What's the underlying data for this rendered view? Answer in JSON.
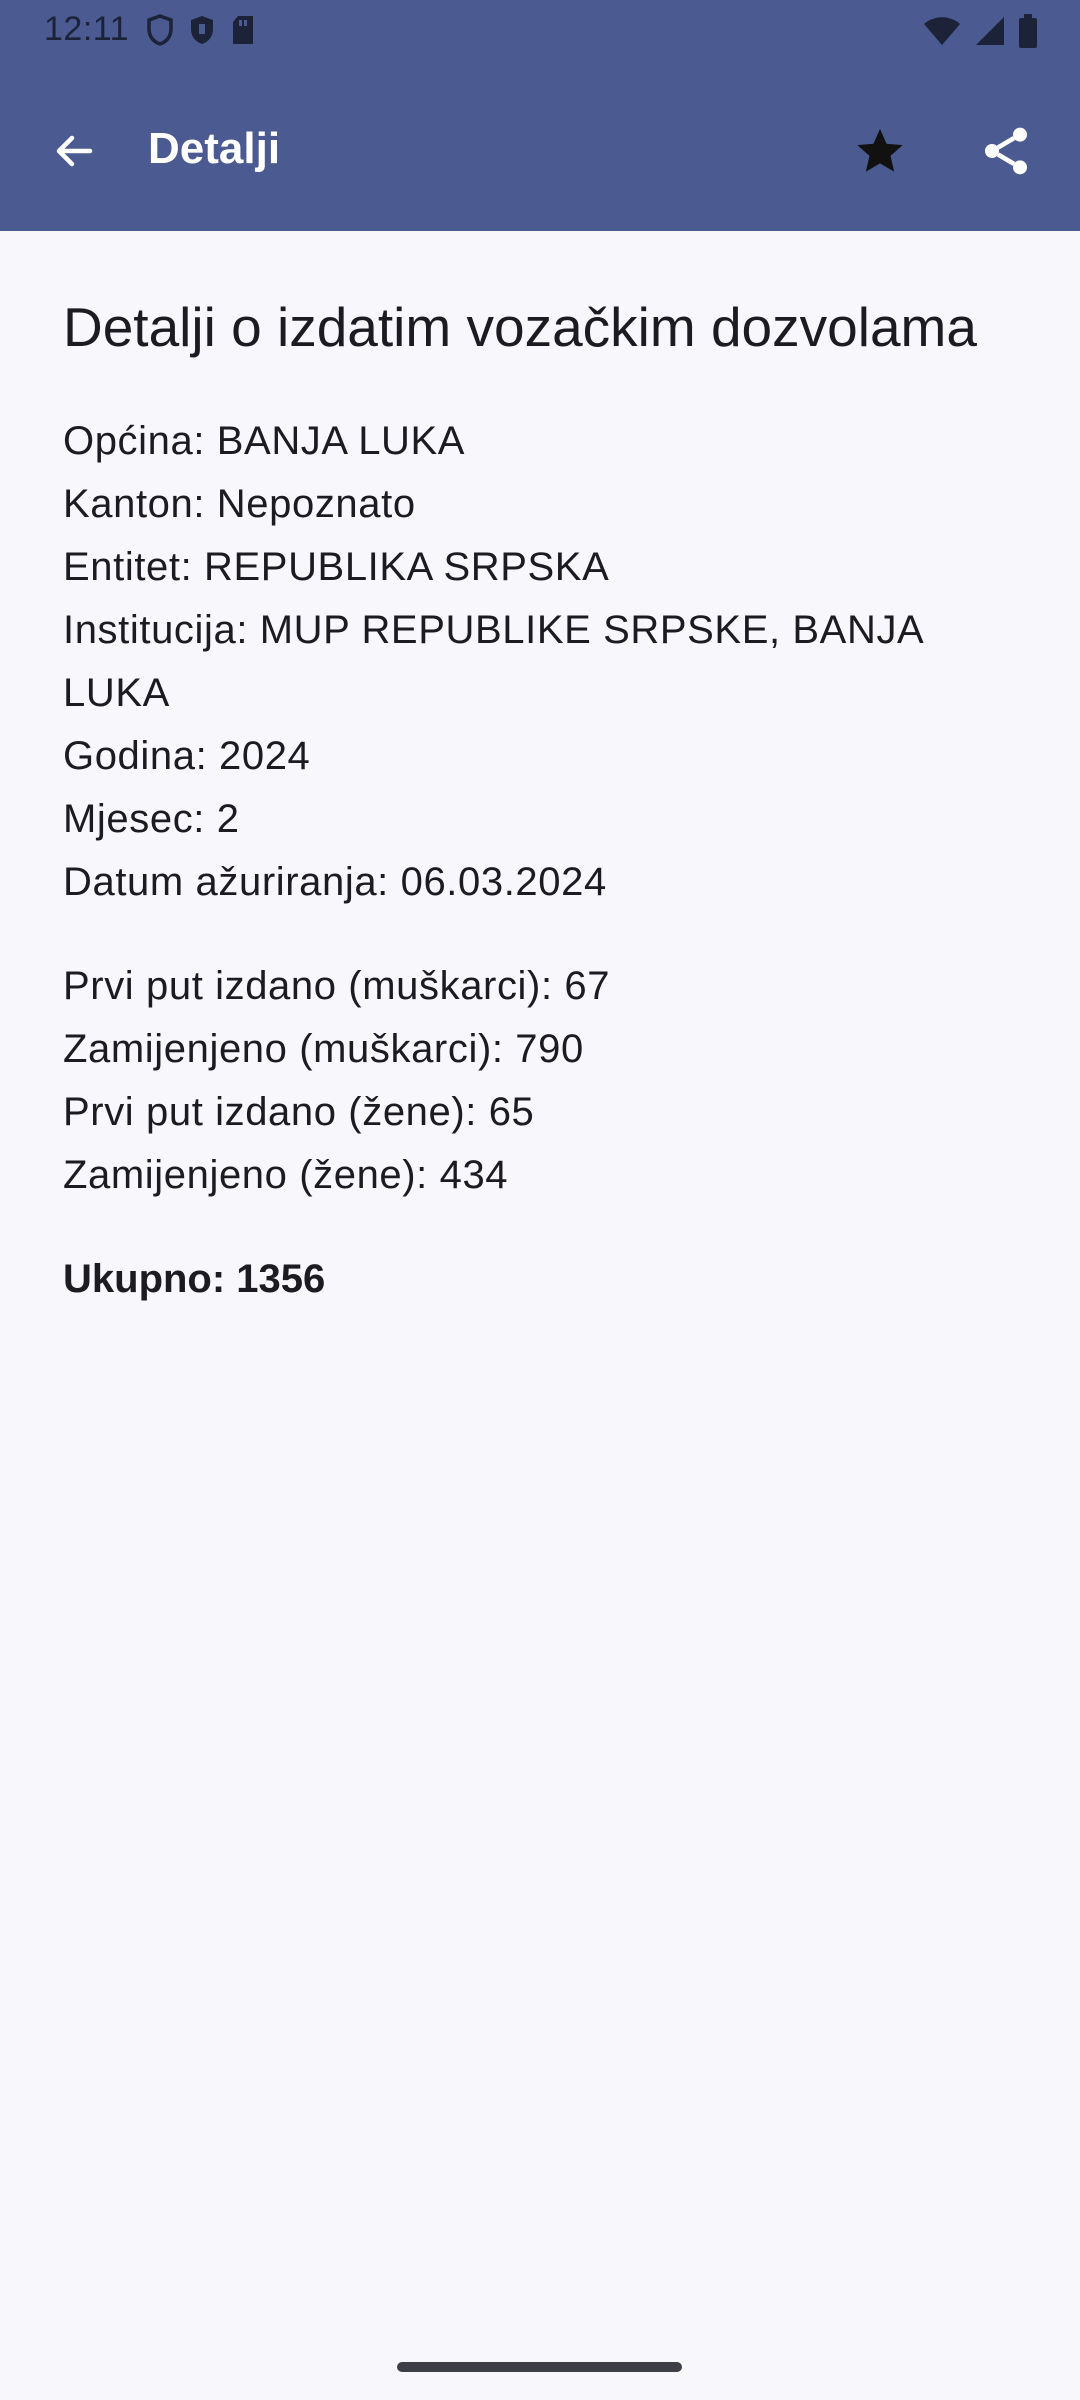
{
  "status_bar": {
    "time": "12:11",
    "left_icons": [
      "shield-outline-icon",
      "shield-filled-icon",
      "sd-card-icon"
    ],
    "right_icons": [
      "wifi-icon",
      "cell-signal-icon",
      "battery-icon"
    ]
  },
  "app_bar": {
    "title": "Detalji",
    "background_color": "#4b5b91",
    "icons": [
      "back-arrow-icon",
      "star-icon",
      "share-icon"
    ]
  },
  "page": {
    "title": "Detalji o izdatim vozačkim dozvolama",
    "details": [
      "Općina: BANJA LUKA",
      "Kanton: Nepoznato",
      "Entitet: REPUBLIKA SRPSKA",
      "Institucija: MUP REPUBLIKE SRPSKE, BANJA LUKA",
      "Godina: 2024",
      "Mjesec: 2",
      "Datum ažuriranja: 06.03.2024"
    ],
    "counts": [
      "Prvi put izdano (muškarci): 67",
      "Zamijenjeno (muškarci): 790",
      "Prvi put izdano (žene): 65",
      "Zamijenjeno (žene): 434"
    ],
    "total": "Ukupno: 1356"
  }
}
